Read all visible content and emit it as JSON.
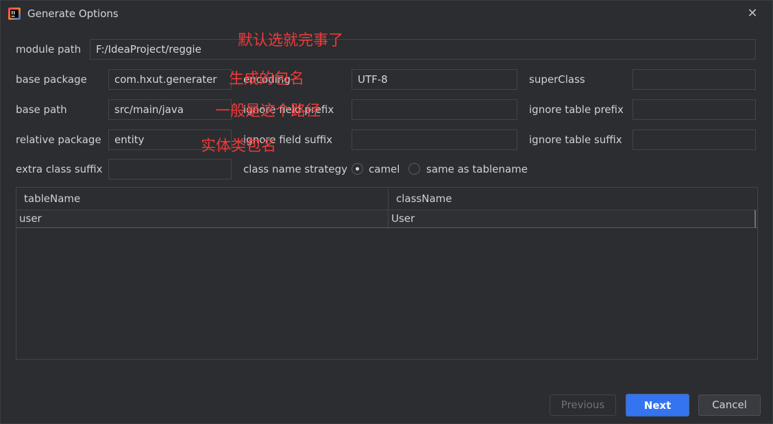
{
  "window": {
    "title": "Generate Options",
    "close_glyph": "✕"
  },
  "form": {
    "module_path_label": "module path",
    "module_path_value": "F:/IdeaProject/reggie",
    "base_package_label": "base package",
    "base_package_value": "com.hxut.generater",
    "base_path_label": "base path",
    "base_path_value": "src/main/java",
    "relative_package_label": "relative package",
    "relative_package_value": "entity",
    "extra_class_suffix_label": "extra class suffix",
    "extra_class_suffix_value": "",
    "encoding_label": "encoding",
    "encoding_value": "UTF-8",
    "ignore_field_prefix_label": "ignore field prefix",
    "ignore_field_prefix_value": "",
    "ignore_field_suffix_label": "ignore field suffix",
    "ignore_field_suffix_value": "",
    "class_name_strategy_label": "class name strategy",
    "strategy_options": [
      "camel",
      "same as tablename"
    ],
    "strategy_selected": "camel",
    "superclass_label": "superClass",
    "superclass_value": "",
    "ignore_table_prefix_label": "ignore table prefix",
    "ignore_table_prefix_value": "",
    "ignore_table_suffix_label": "ignore table suffix",
    "ignore_table_suffix_value": ""
  },
  "annotations": {
    "module_path_note": "默认选就完事了",
    "base_package_note": "生成的包名",
    "base_path_note": "一般是这个路径",
    "relative_package_note": "实体类包名"
  },
  "table": {
    "columns": [
      "tableName",
      "className"
    ],
    "rows": [
      [
        "user",
        "User"
      ]
    ]
  },
  "buttons": {
    "previous": "Previous",
    "next": "Next",
    "cancel": "Cancel"
  },
  "colors": {
    "background": "#2b2d30",
    "accent": "#3574f0",
    "annotation": "#ef3a3a"
  }
}
